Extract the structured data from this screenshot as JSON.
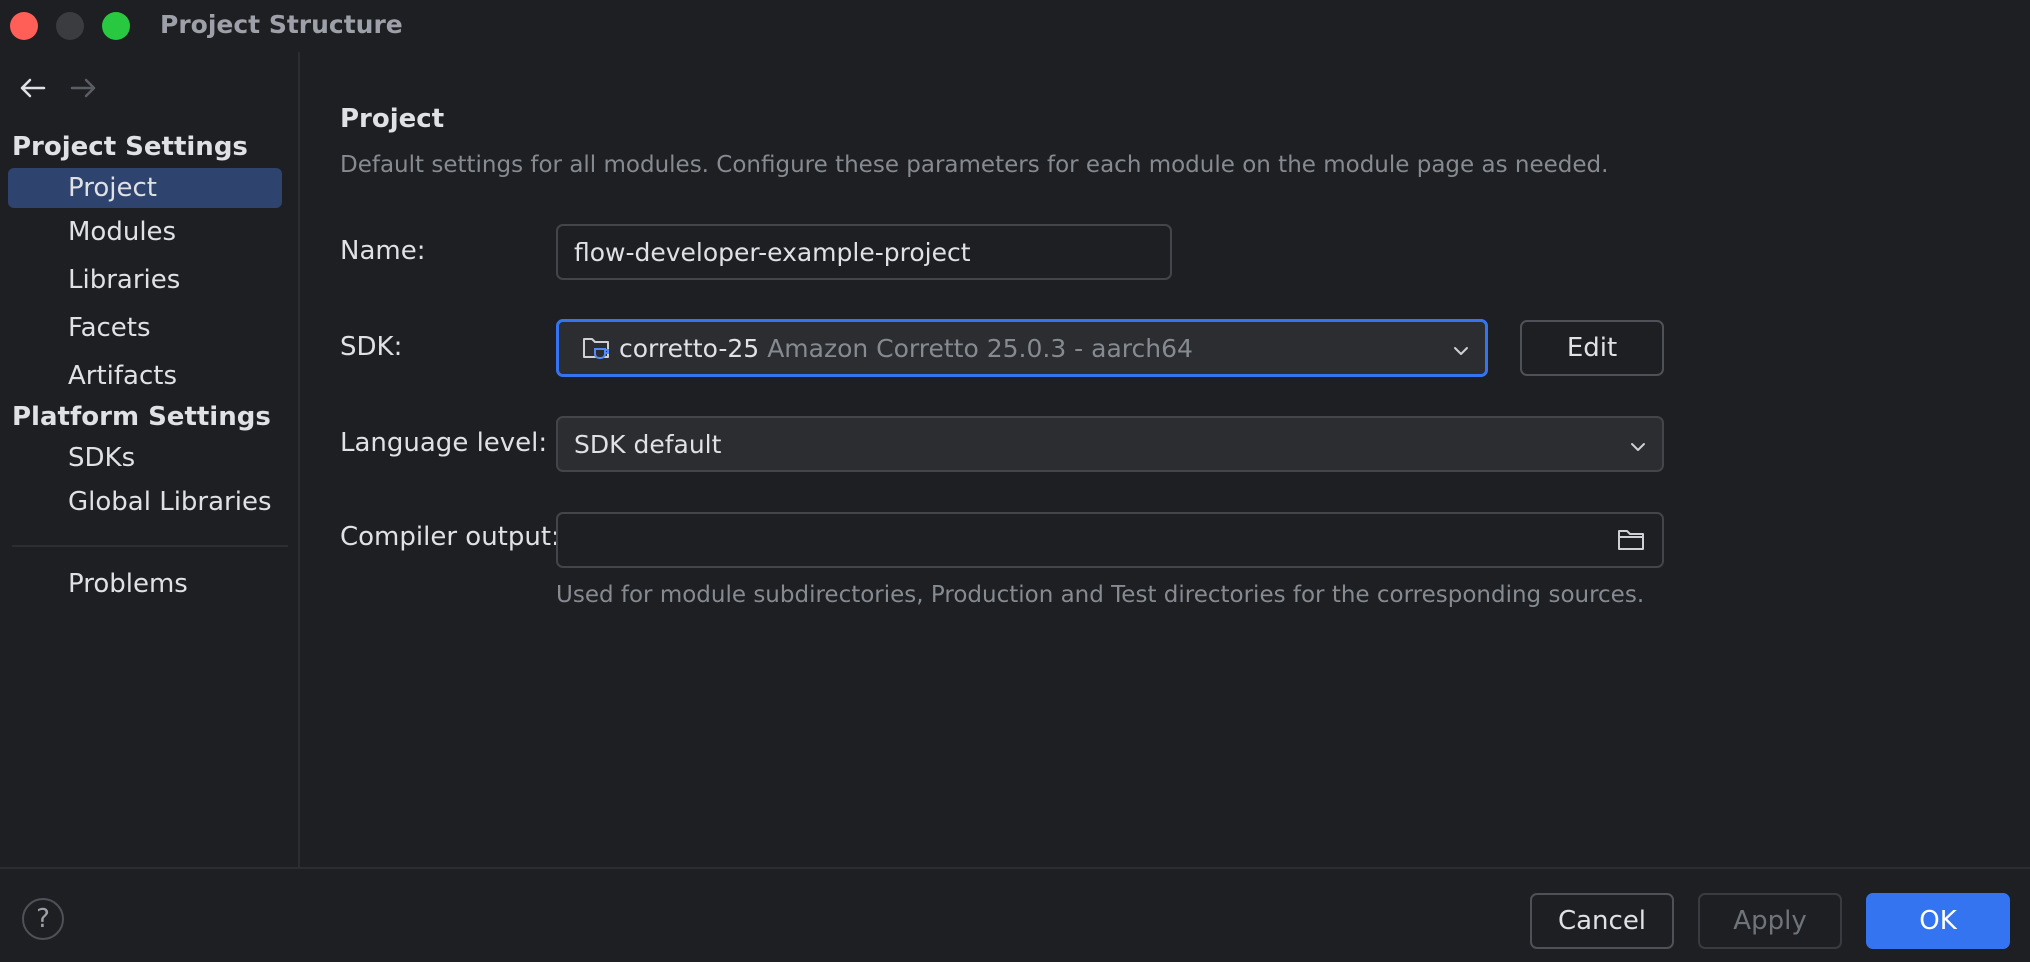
{
  "window": {
    "title": "Project Structure"
  },
  "sidebar": {
    "project_settings_header": "Project Settings",
    "project_items": [
      {
        "label": "Project",
        "selected": true
      },
      {
        "label": "Modules"
      },
      {
        "label": "Libraries"
      },
      {
        "label": "Facets"
      },
      {
        "label": "Artifacts"
      }
    ],
    "platform_settings_header": "Platform Settings",
    "platform_items": [
      {
        "label": "SDKs"
      },
      {
        "label": "Global Libraries"
      }
    ],
    "problems_label": "Problems"
  },
  "main": {
    "title": "Project",
    "description": "Default settings for all modules. Configure these parameters for each module on the module page as needed.",
    "name_label": "Name:",
    "name_value": "flow-developer-example-project",
    "sdk_label": "SDK:",
    "sdk_name": "corretto-25",
    "sdk_detail": "Amazon Corretto 25.0.3 - aarch64",
    "edit_label": "Edit",
    "language_level_label": "Language level:",
    "language_level_value": "SDK default",
    "compiler_output_label": "Compiler output:",
    "compiler_output_value": "",
    "compiler_output_hint": "Used for module subdirectories, Production and Test directories for the corresponding sources."
  },
  "footer": {
    "help_label": "?",
    "cancel_label": "Cancel",
    "apply_label": "Apply",
    "ok_label": "OK"
  },
  "colors": {
    "background": "#1e1f22",
    "selection": "#2e436e",
    "accent": "#3574f0",
    "text": "#dfe1e5",
    "muted_text": "#868a91"
  },
  "icons": {
    "back": "arrow-left-icon",
    "forward": "arrow-right-icon",
    "sdk": "jdk-folder-icon",
    "chevron": "chevron-down-icon",
    "folder": "folder-icon",
    "help": "help-icon"
  }
}
